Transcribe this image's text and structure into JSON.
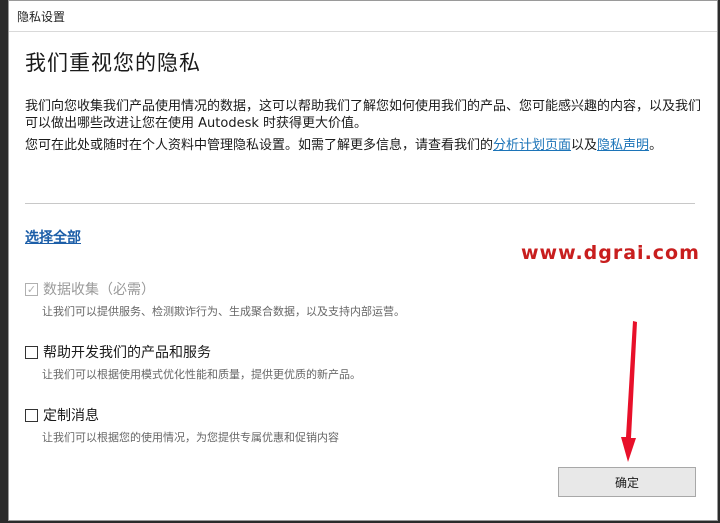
{
  "window": {
    "title": "隐私设置"
  },
  "heading": "我们重视您的隐私",
  "intro": {
    "text": "我们向您收集我们产品使用情况的数据，这可以帮助我们了解您如何使用我们的产品、您可能感兴趣的内容，以及我们可以做出哪些改进让您在使用 Autodesk 时获得更大价值。"
  },
  "manage": {
    "prefix": "您可在此处或随时在个人资料中管理隐私设置。如需了解更多信息，请查看我们的",
    "link1": "分析计划页面",
    "middle": "以及",
    "link2": "隐私声明",
    "suffix": "。"
  },
  "select_all": "选择全部",
  "watermark": "www.dgrai.com",
  "options": [
    {
      "label": "数据收集（必需）",
      "desc": "让我们可以提供服务、检测欺诈行为、生成聚合数据，以及支持内部运营。",
      "checked": true,
      "disabled": true
    },
    {
      "label": "帮助开发我们的产品和服务",
      "desc": "让我们可以根据使用模式优化性能和质量，提供更优质的新产品。",
      "checked": false,
      "disabled": false
    },
    {
      "label": "定制消息",
      "desc": "让我们可以根据您的使用情况，为您提供专属优惠和促销内容",
      "checked": false,
      "disabled": false
    }
  ],
  "ok_button": "确定",
  "colors": {
    "link": "#1c74b8",
    "watermark": "#c81e1e",
    "annotation": "#e8102a"
  },
  "glyphs": {
    "check": "✓"
  }
}
